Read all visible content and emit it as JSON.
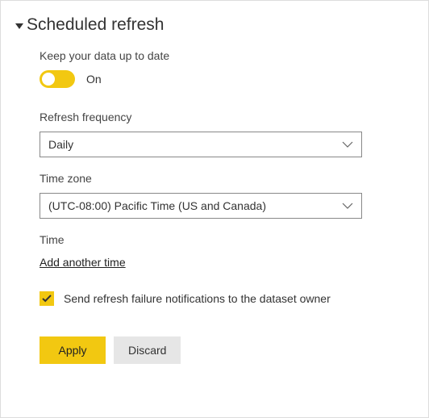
{
  "header": {
    "title": "Scheduled refresh"
  },
  "keepUpToDate": {
    "label": "Keep your data up to date",
    "toggleState": "On"
  },
  "frequency": {
    "label": "Refresh frequency",
    "value": "Daily"
  },
  "timeZone": {
    "label": "Time zone",
    "value": "(UTC-08:00) Pacific Time (US and Canada)"
  },
  "time": {
    "label": "Time",
    "addLink": "Add another time"
  },
  "notify": {
    "label": "Send refresh failure notifications to the dataset owner",
    "checked": true
  },
  "buttons": {
    "apply": "Apply",
    "discard": "Discard"
  }
}
